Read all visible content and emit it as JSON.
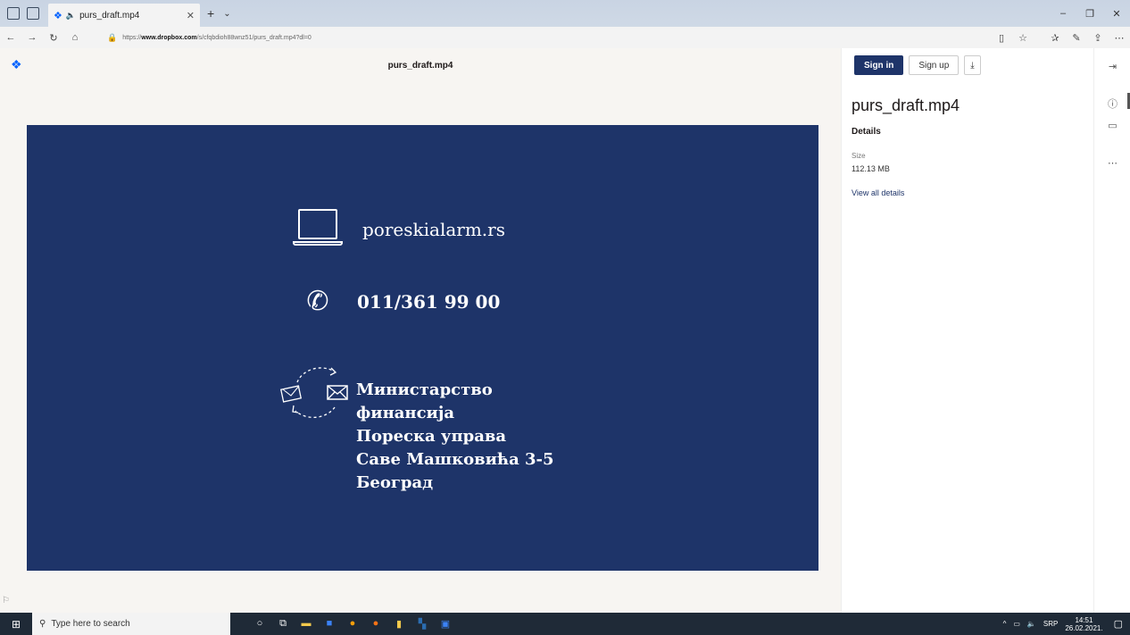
{
  "browser": {
    "tab_title": "purs_draft.mp4",
    "url_prefix": "https://",
    "url_domain": "www.dropbox.com",
    "url_path": "/s/cfqbdioh88wnz51/purs_draft.mp4?dl=0"
  },
  "header": {
    "file_title": "purs_draft.mp4"
  },
  "video": {
    "website": "poreskialarm.rs",
    "phone": "011/361 99 00",
    "address_lines": [
      "Министарство",
      "финансија",
      "Пореска управа",
      "Саве Машковића 3-5",
      "Београд"
    ]
  },
  "panel": {
    "sign_in": "Sign in",
    "sign_up": "Sign up",
    "file_name": "purs_draft.mp4",
    "details_heading": "Details",
    "size_label": "Size",
    "size_value": "112.13 MB",
    "view_all": "View all details"
  },
  "taskbar": {
    "search_placeholder": "Type here to search",
    "language": "SRP",
    "time": "14:51",
    "date": "26.02.2021."
  },
  "colors": {
    "video_bg": "#1e3469",
    "brand": "#0061fe"
  }
}
